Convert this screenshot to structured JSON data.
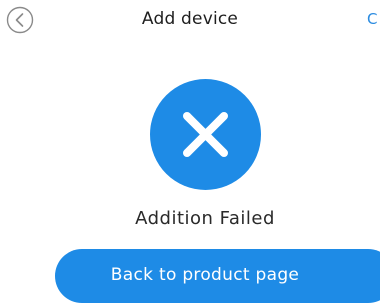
{
  "header": {
    "title": "Add device",
    "action_label": "C",
    "back_icon": "chevron-left-circle-icon"
  },
  "result": {
    "icon": "close-icon",
    "icon_color": "#1e8be6",
    "message": "Addition Failed"
  },
  "actions": {
    "back_to_product_label": "Back to product page",
    "button_color": "#1e8be6"
  }
}
